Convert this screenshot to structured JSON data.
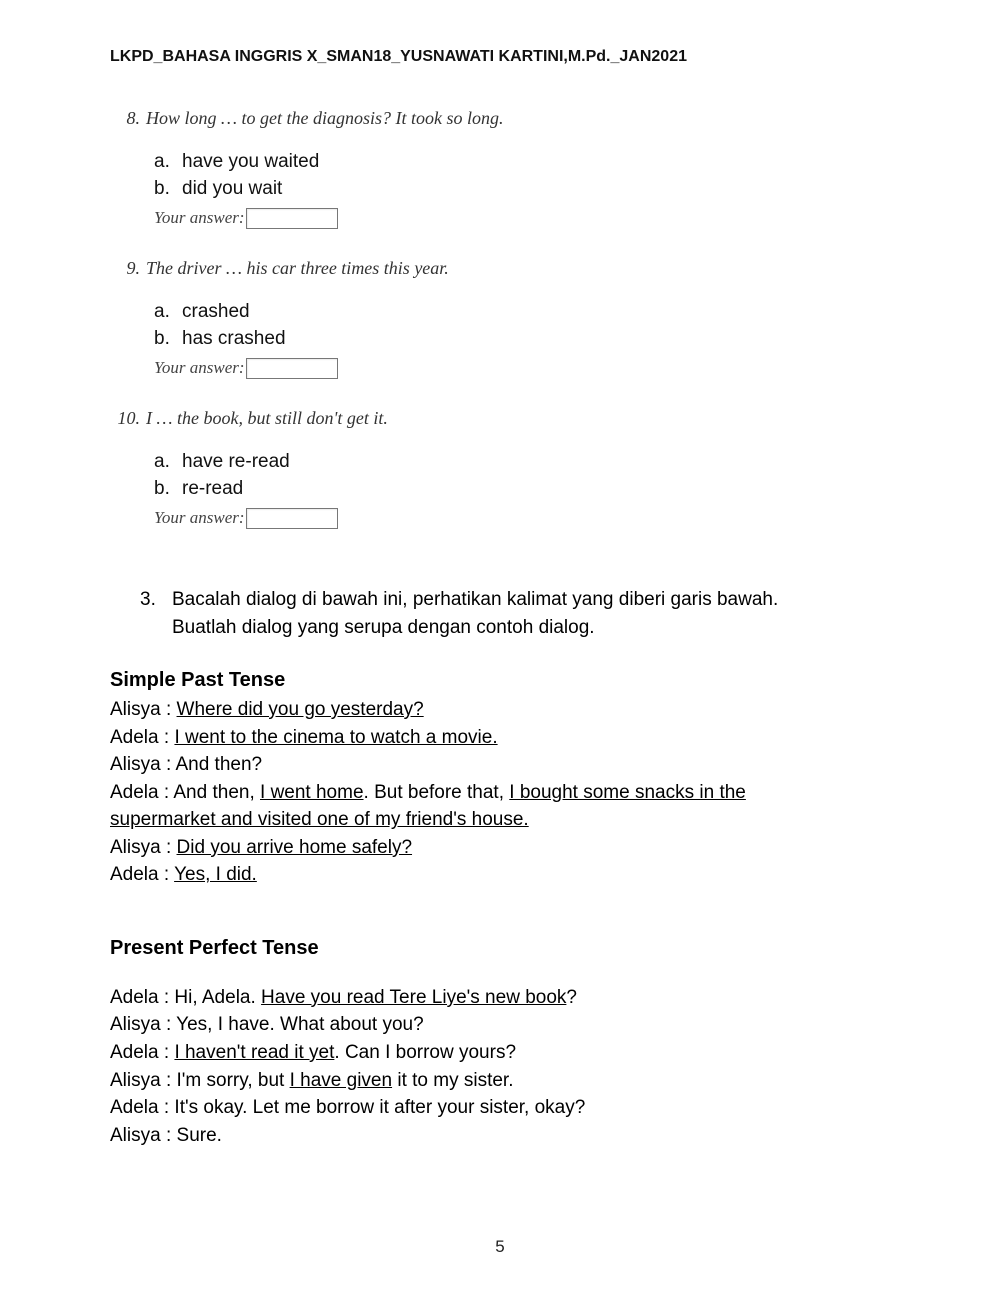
{
  "header": "LKPD_BAHASA INGGRIS X_SMAN18_YUSNAWATI KARTINI,M.Pd._JAN2021",
  "questions": [
    {
      "num": "8.",
      "text": "How long … to get the diagnosis? It took so long.",
      "opt_a_letter": "a.",
      "opt_a_text": "have you waited",
      "opt_b_letter": "b.",
      "opt_b_text": "did you wait",
      "answer_label": "Your answer:"
    },
    {
      "num": "9.",
      "text": "The driver … his car three times this year.",
      "opt_a_letter": "a.",
      "opt_a_text": "crashed",
      "opt_b_letter": "b.",
      "opt_b_text": "has crashed",
      "answer_label": "Your answer:"
    },
    {
      "num": "10.",
      "text": "I … the book, but still don't get it.",
      "opt_a_letter": "a.",
      "opt_a_text": "have re-read",
      "opt_b_letter": "b.",
      "opt_b_text": "re-read",
      "answer_label": "Your answer:"
    }
  ],
  "instruction": {
    "num": "3.",
    "line1": "Bacalah dialog di bawah ini, perhatikan kalimat yang diberi garis bawah.",
    "line2": "Buatlah dialog yang serupa dengan contoh dialog."
  },
  "section1_title": "Simple Past Tense",
  "dialog1": {
    "l1_speaker": "Alisya : ",
    "l1_u": "Where did you go yesterday?",
    "l2_speaker": "Adela : ",
    "l2_u": "I went to the cinema to watch a movie.",
    "l3": "Alisya : And then?",
    "l4_a": "Adela : And then, ",
    "l4_u1": "I went home",
    "l4_b": ". But before that, ",
    "l4_u2": "I bought some snacks in the",
    "l4c_u": "supermarket and visited one of my friend's house.",
    "l5_speaker": "Alisya : ",
    "l5_u": "Did you arrive home safely?",
    "l6_speaker": "Adela : ",
    "l6_u": "Yes, I did."
  },
  "section2_title": "Present Perfect Tense",
  "dialog2": {
    "l1_a": "Adela : Hi, Adela. ",
    "l1_u": "Have you read Tere Liye's new book",
    "l1_b": "?",
    "l2": "Alisya : Yes, I have. What about you?",
    "l3_a": "Adela : ",
    "l3_u": "I haven't read it yet",
    "l3_b": ". Can I borrow yours?",
    "l4_a": "Alisya : I'm sorry, but ",
    "l4_u": "I have given",
    "l4_b": " it to my sister.",
    "l5": "Adela : It's okay. Let me borrow it after your sister, okay?",
    "l6": "Alisya : Sure."
  },
  "page_number": "5"
}
